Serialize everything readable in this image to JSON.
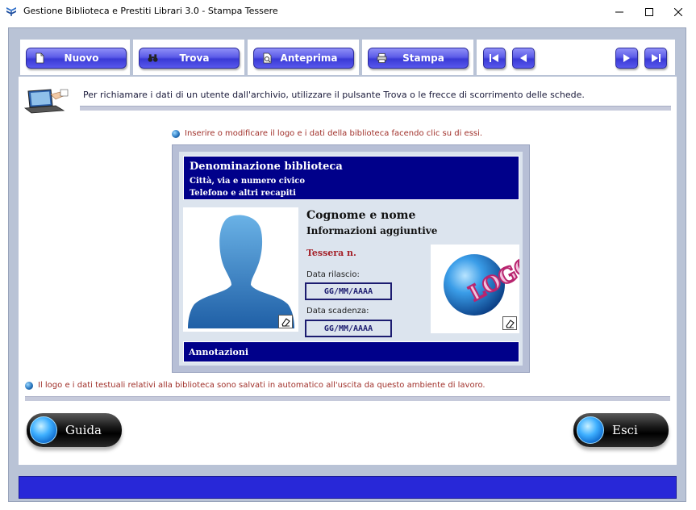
{
  "window": {
    "title": "Gestione Biblioteca e Prestiti Librari 3.0 - Stampa Tessere",
    "app_icon": "book-stack-icon",
    "controls": [
      "minimize-icon",
      "maximize-icon",
      "close-icon"
    ]
  },
  "toolbar": {
    "buttons": [
      {
        "label": "Nuovo",
        "icon": "new-document-icon"
      },
      {
        "label": "Trova",
        "icon": "binoculars-icon"
      },
      {
        "label": "Anteprima",
        "icon": "preview-icon"
      },
      {
        "label": "Stampa",
        "icon": "printer-icon"
      }
    ],
    "nav": [
      "first-record-icon",
      "previous-record-icon",
      "next-record-icon",
      "last-record-icon"
    ]
  },
  "info": {
    "text": "Per richiamare i dati di un utente dall'archivio, utilizzare il pulsante Trova o le frecce di scorrimento delle schede.",
    "icon": "laptop-hand-icon"
  },
  "hints": {
    "top": "Inserire o modificare il logo e i dati della biblioteca facendo clic su di essi.",
    "bottom": "Il logo e i dati testuali relativi alla biblioteca sono salvati in automatico all'uscita da questo ambiente di lavoro."
  },
  "card": {
    "library_name": "Denominazione biblioteca",
    "library_address": "Città, via e numero civico",
    "library_phone": "Telefono e altri recapiti",
    "person_name": "Cognome e nome",
    "person_info": "Informazioni aggiuntive",
    "card_number_label": "Tessera n.",
    "issue_date_label": "Data rilascio:",
    "issue_date_value": "GG/MM/AAAA",
    "expiry_date_label": "Data scadenza:",
    "expiry_date_value": "GG/MM/AAAA",
    "notes_label": "Annotazioni",
    "logo_text": "LOGO"
  },
  "footer": {
    "help_label": "Guida",
    "exit_label": "Esci"
  },
  "colors": {
    "accent_blue": "#00008a",
    "button_blue": "#5c5ce8",
    "status_bar": "#2828d8",
    "hint_red": "#a0302a",
    "frame": "#b9c3d6"
  }
}
